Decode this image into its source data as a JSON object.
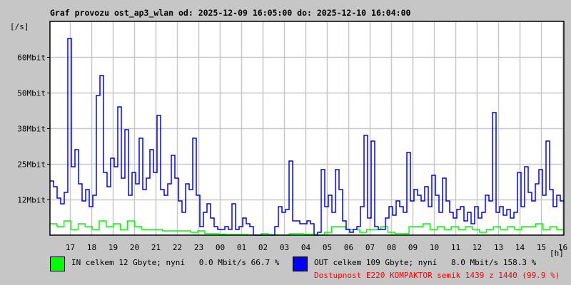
{
  "chart_data": {
    "type": "line",
    "title": "Graf provozu ost_ap3_wlan od: 2025-12-09 16:05:00 do: 2025-12-10 16:04:00",
    "ylabel": "[/s]",
    "xlabel": "[h]",
    "ylim": [
      0,
      75
    ],
    "y_unit": "Mbit/s",
    "y_ticks": [
      {
        "value": 12.5,
        "label": "12Mbit"
      },
      {
        "value": 25,
        "label": "25Mbit"
      },
      {
        "value": 37.5,
        "label": "38Mbit"
      },
      {
        "value": 50,
        "label": "50Mbit"
      },
      {
        "value": 62.5,
        "label": "60Mbit"
      }
    ],
    "x_range_minutes": [
      0,
      1440
    ],
    "x_start": "16:05",
    "x_ticks": [
      {
        "minute": 55,
        "label": "17"
      },
      {
        "minute": 115,
        "label": "18"
      },
      {
        "minute": 175,
        "label": "19"
      },
      {
        "minute": 235,
        "label": "20"
      },
      {
        "minute": 295,
        "label": "21"
      },
      {
        "minute": 355,
        "label": "22"
      },
      {
        "minute": 415,
        "label": "23"
      },
      {
        "minute": 475,
        "label": "00"
      },
      {
        "minute": 535,
        "label": "01"
      },
      {
        "minute": 595,
        "label": "02"
      },
      {
        "minute": 655,
        "label": "03"
      },
      {
        "minute": 715,
        "label": "04"
      },
      {
        "minute": 775,
        "label": "05"
      },
      {
        "minute": 835,
        "label": "06"
      },
      {
        "minute": 895,
        "label": "07"
      },
      {
        "minute": 955,
        "label": "08"
      },
      {
        "minute": 1015,
        "label": "09"
      },
      {
        "minute": 1075,
        "label": "10"
      },
      {
        "minute": 1135,
        "label": "11"
      },
      {
        "minute": 1195,
        "label": "12"
      },
      {
        "minute": 1255,
        "label": "13"
      },
      {
        "minute": 1315,
        "label": "14"
      },
      {
        "minute": 1375,
        "label": "15"
      },
      {
        "minute": 1435,
        "label": "16"
      }
    ],
    "grid": true,
    "series": [
      {
        "name": "OUT",
        "color": "#0000ff",
        "values": [
          19,
          17,
          13,
          11,
          15,
          69,
          24,
          30,
          18,
          12,
          16,
          10,
          14,
          49,
          56,
          22,
          17,
          27,
          24,
          45,
          20,
          37,
          14,
          22,
          18,
          34,
          16,
          20,
          30,
          22,
          42,
          16,
          14,
          18,
          28,
          20,
          12,
          8,
          18,
          16,
          34,
          14,
          3,
          8,
          11,
          6,
          3,
          2,
          2,
          3,
          2,
          11,
          2,
          3,
          6,
          4,
          3,
          0,
          0,
          0,
          0,
          0,
          0,
          3,
          10,
          8,
          9,
          26,
          5,
          5,
          4,
          4,
          5,
          4,
          0,
          1,
          23,
          10,
          14,
          8,
          23,
          16,
          5,
          2,
          1,
          2,
          3,
          10,
          35,
          6,
          33,
          3,
          2,
          2,
          6,
          10,
          7,
          12,
          10,
          8,
          29,
          12,
          16,
          14,
          12,
          17,
          10,
          21,
          14,
          8,
          20,
          12,
          8,
          6,
          9,
          10,
          5,
          8,
          4,
          10,
          6,
          8,
          14,
          12,
          43,
          8,
          10,
          7,
          9,
          6,
          8,
          22,
          10,
          24,
          15,
          12,
          18,
          23,
          14,
          33,
          16,
          10,
          14,
          12
        ]
      },
      {
        "name": "IN",
        "color": "#00ff00",
        "values": [
          4,
          3,
          5,
          2,
          4,
          3,
          2,
          5,
          3,
          4,
          2,
          5,
          3,
          2,
          2,
          2,
          1.5,
          1.5,
          1.5,
          1.5,
          1,
          1.5,
          0.5,
          0.5,
          0.3,
          0.2,
          0.2,
          0.2,
          0,
          0,
          0.5,
          0.2,
          0,
          0,
          0.5,
          0.5,
          0.3,
          0.3,
          0,
          1,
          3,
          3,
          2,
          2,
          1,
          2,
          2,
          3,
          1,
          0.5,
          0.5,
          3,
          3,
          4,
          2,
          3,
          2,
          3,
          2,
          3,
          2,
          1,
          2,
          3,
          2,
          3,
          2,
          3,
          3,
          4,
          2,
          3,
          2
        ]
      }
    ]
  },
  "legend": {
    "in": {
      "color": "#00ff00",
      "text": "IN celkem 12 Gbyte; nyní   0.0 Mbit/s 66.7 %"
    },
    "out": {
      "color": "#0000ff",
      "text": "OUT celkem 109 Gbyte; nyní   8.0 Mbit/s 158.3 %"
    },
    "availability": "Dostupnost E220 KOMPAKTOR semik 1439 z 1440 (99.9 %)"
  }
}
